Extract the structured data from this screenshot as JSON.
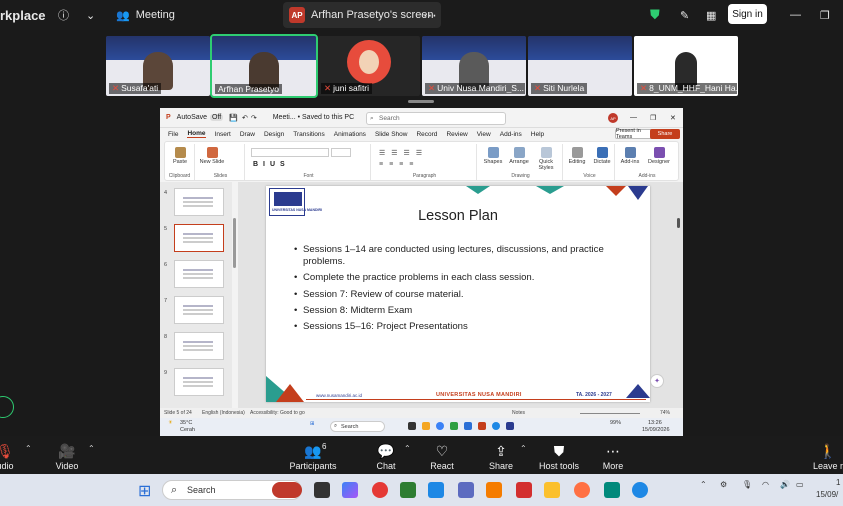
{
  "topbar": {
    "app_fragment": "rkplace",
    "meeting_label": "Meeting",
    "screen_badge": "AP",
    "screen_title": "Arfhan Prasetyo's screen",
    "more_label": "⋯",
    "signin_label": "Sign in"
  },
  "participants": [
    {
      "name": "Susafa'ati"
    },
    {
      "name": "Arfhan Prasetyo"
    },
    {
      "name": "juni safitri"
    },
    {
      "name": "Univ Nusa Mandiri_S..."
    },
    {
      "name": "Siti Nurlela"
    },
    {
      "name": "8_UNM_HHF_Hani Ha..."
    }
  ],
  "powerpoint": {
    "autosave": "AutoSave",
    "autosave_state": "Off",
    "file_title": "Meeti... • Saved to this PC",
    "search_placeholder": "Search",
    "user_badge": "AP",
    "menu": [
      "File",
      "Home",
      "Insert",
      "Draw",
      "Design",
      "Transitions",
      "Animations",
      "Slide Show",
      "Record",
      "Review",
      "View",
      "Add-ins",
      "Help"
    ],
    "present_label": "Present in Teams",
    "share_label": "Share",
    "ribbon": {
      "paste": "Paste",
      "new_slide": "New Slide",
      "groups": [
        "Clipboard",
        "Slides",
        "Font",
        "Paragraph",
        "Drawing",
        "Voice",
        "Add-ins"
      ],
      "shapes": "Shapes",
      "arrange": "Arrange",
      "quick_styles": "Quick Styles",
      "editing": "Editing",
      "dictate": "Dictate",
      "add_ins": "Add-ins",
      "designer": "Designer"
    },
    "thumb_numbers": [
      "4",
      "5",
      "6",
      "7",
      "8",
      "9"
    ],
    "slide": {
      "logo_text": "UNIVERSITAS NUSA MANDIRI",
      "title": "Lesson Plan",
      "bullets": [
        "Sessions 1–14 are conducted using lectures, discussions, and practice problems.",
        "Complete the practice problems in each class session.",
        "Session 7: Review of course material.",
        "Session 8: Midterm Exam",
        "Sessions 15–16: Project Presentations"
      ],
      "footer_web": "www.nusamandiri.ac.id",
      "footer_uni": "UNIVERSITAS NUSA MANDIRI",
      "footer_year": "TA. 2026 - 2027"
    },
    "status": {
      "slide_count": "Slide 5 of 24",
      "language": "English (Indonesia)",
      "accessibility": "Accessibility: Good to go",
      "notes": "Notes",
      "zoom": "74%"
    },
    "mini_taskbar": {
      "weather_temp": "35°C",
      "weather_desc": "Cerah",
      "search": "Search",
      "battery": "99%",
      "time": "13:26",
      "date": "15/09/2026"
    }
  },
  "controls": {
    "audio": "udio",
    "video": "Video",
    "participants": "Participants",
    "participants_count": "6",
    "chat": "Chat",
    "react": "React",
    "share": "Share",
    "host_tools": "Host tools",
    "more": "More",
    "leave": "Leave r"
  },
  "taskbar": {
    "search": "Search",
    "time_fragment": "1",
    "date_fragment": "15/09/"
  },
  "colors": {
    "zoom_bg": "#1b1b1b",
    "accent_red": "#c43e1c",
    "active_speaker": "#2ecc71",
    "brand_blue": "#2b3b8f",
    "teal": "#2a9d8f"
  }
}
